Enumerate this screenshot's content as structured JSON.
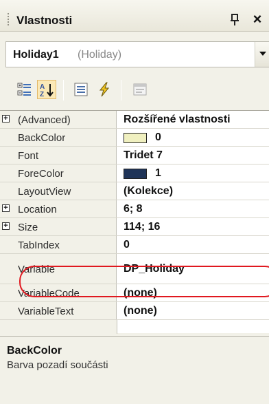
{
  "panel": {
    "title": "Vlastnosti",
    "pin_glyph": "Ԅ",
    "close_glyph": "×"
  },
  "object_selector": {
    "name": "Holiday1",
    "type": "(Holiday)"
  },
  "toolbar": {
    "icons": [
      "categorized-icon",
      "alphabetical-icon",
      "properties-icon",
      "events-icon",
      "property-pages-icon"
    ],
    "pressed": "alphabetical-icon"
  },
  "properties": [
    {
      "name": "(Advanced)",
      "value": "Rozšířené vlastnosti",
      "expandable": true
    },
    {
      "name": "BackColor",
      "value": "0",
      "swatch": "#f0f0c0"
    },
    {
      "name": "Font",
      "value": "Tridet 7"
    },
    {
      "name": "ForeColor",
      "value": "1",
      "swatch": "#1f3458"
    },
    {
      "name": "LayoutView",
      "value": "(Kolekce)"
    },
    {
      "name": "Location",
      "value": "6; 8",
      "expandable": true
    },
    {
      "name": "Size",
      "value": "114; 16",
      "expandable": true
    },
    {
      "name": "TabIndex",
      "value": "0"
    },
    {
      "name": "Variable",
      "value": "DP_Holiday"
    },
    {
      "name": "VariableCode",
      "value": "(none)"
    },
    {
      "name": "VariableText",
      "value": "(none)"
    }
  ],
  "description": {
    "title": "BackColor",
    "text": "Barva pozadí součásti"
  },
  "colors": {
    "highlight": "#e0181f",
    "pressed_bg": "#fbe9b7"
  }
}
